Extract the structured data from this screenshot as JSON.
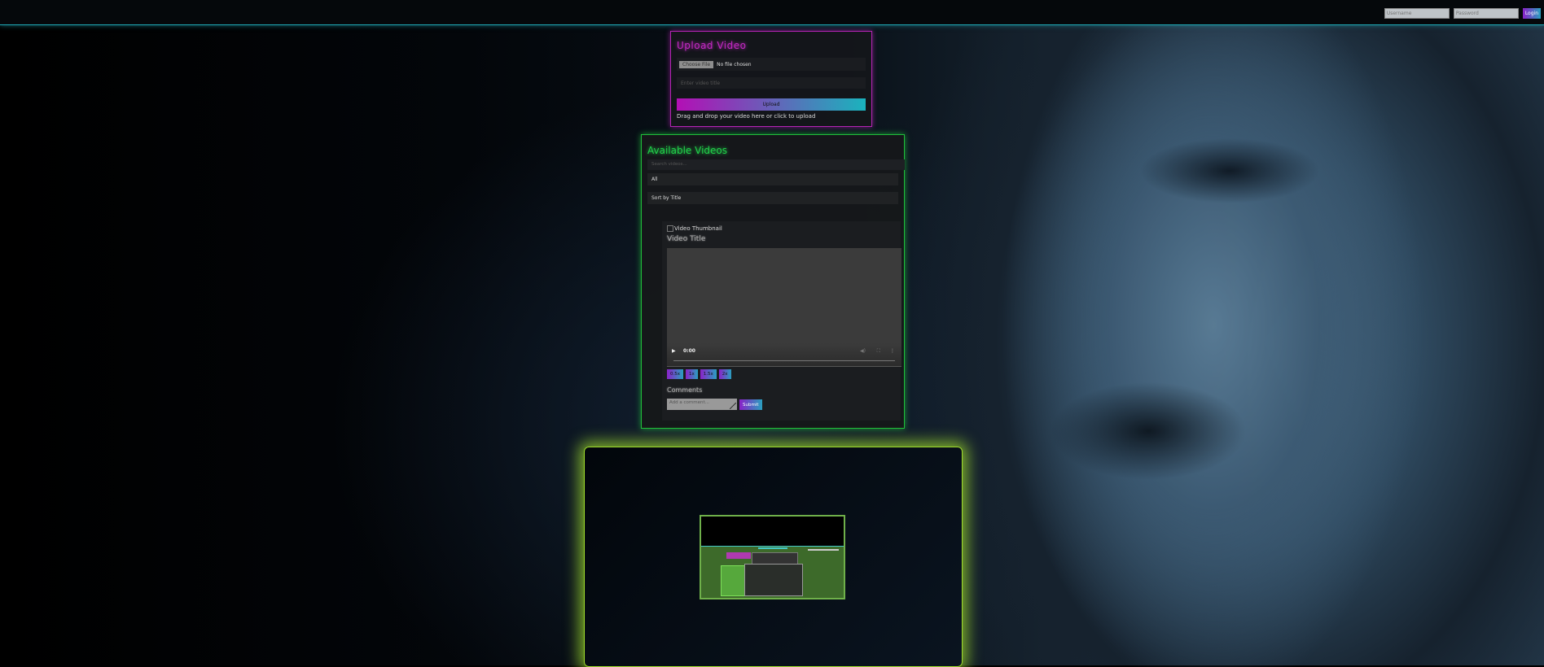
{
  "topbar": {
    "username_placeholder": "Username",
    "password_placeholder": "Password",
    "login_label": "Login"
  },
  "upload": {
    "title": "Upload Video",
    "choose_file_label": "Choose File",
    "file_status": "No file chosen",
    "title_placeholder": "Enter video title",
    "upload_label": "Upload",
    "drop_text": "Drag and drop your video here or click to upload"
  },
  "videos": {
    "title": "Available Videos",
    "search_placeholder": "Search videos...",
    "category_selected": "All",
    "sort_selected": "Sort by Title",
    "card": {
      "thumbnail_alt": "Video Thumbnail",
      "video_title": "Video Title",
      "player_time": "0:00",
      "speeds": [
        "0.5x",
        "1x",
        "1.5x",
        "2x"
      ],
      "comments_heading": "Comments",
      "comment_placeholder": "Add a comment...",
      "submit_label": "Submit"
    }
  },
  "colors": {
    "upload_accent": "#c229c2",
    "videos_accent": "#21d04a",
    "topbar_line": "#1ea7b5",
    "preview_glow": "#9fdc2c"
  }
}
